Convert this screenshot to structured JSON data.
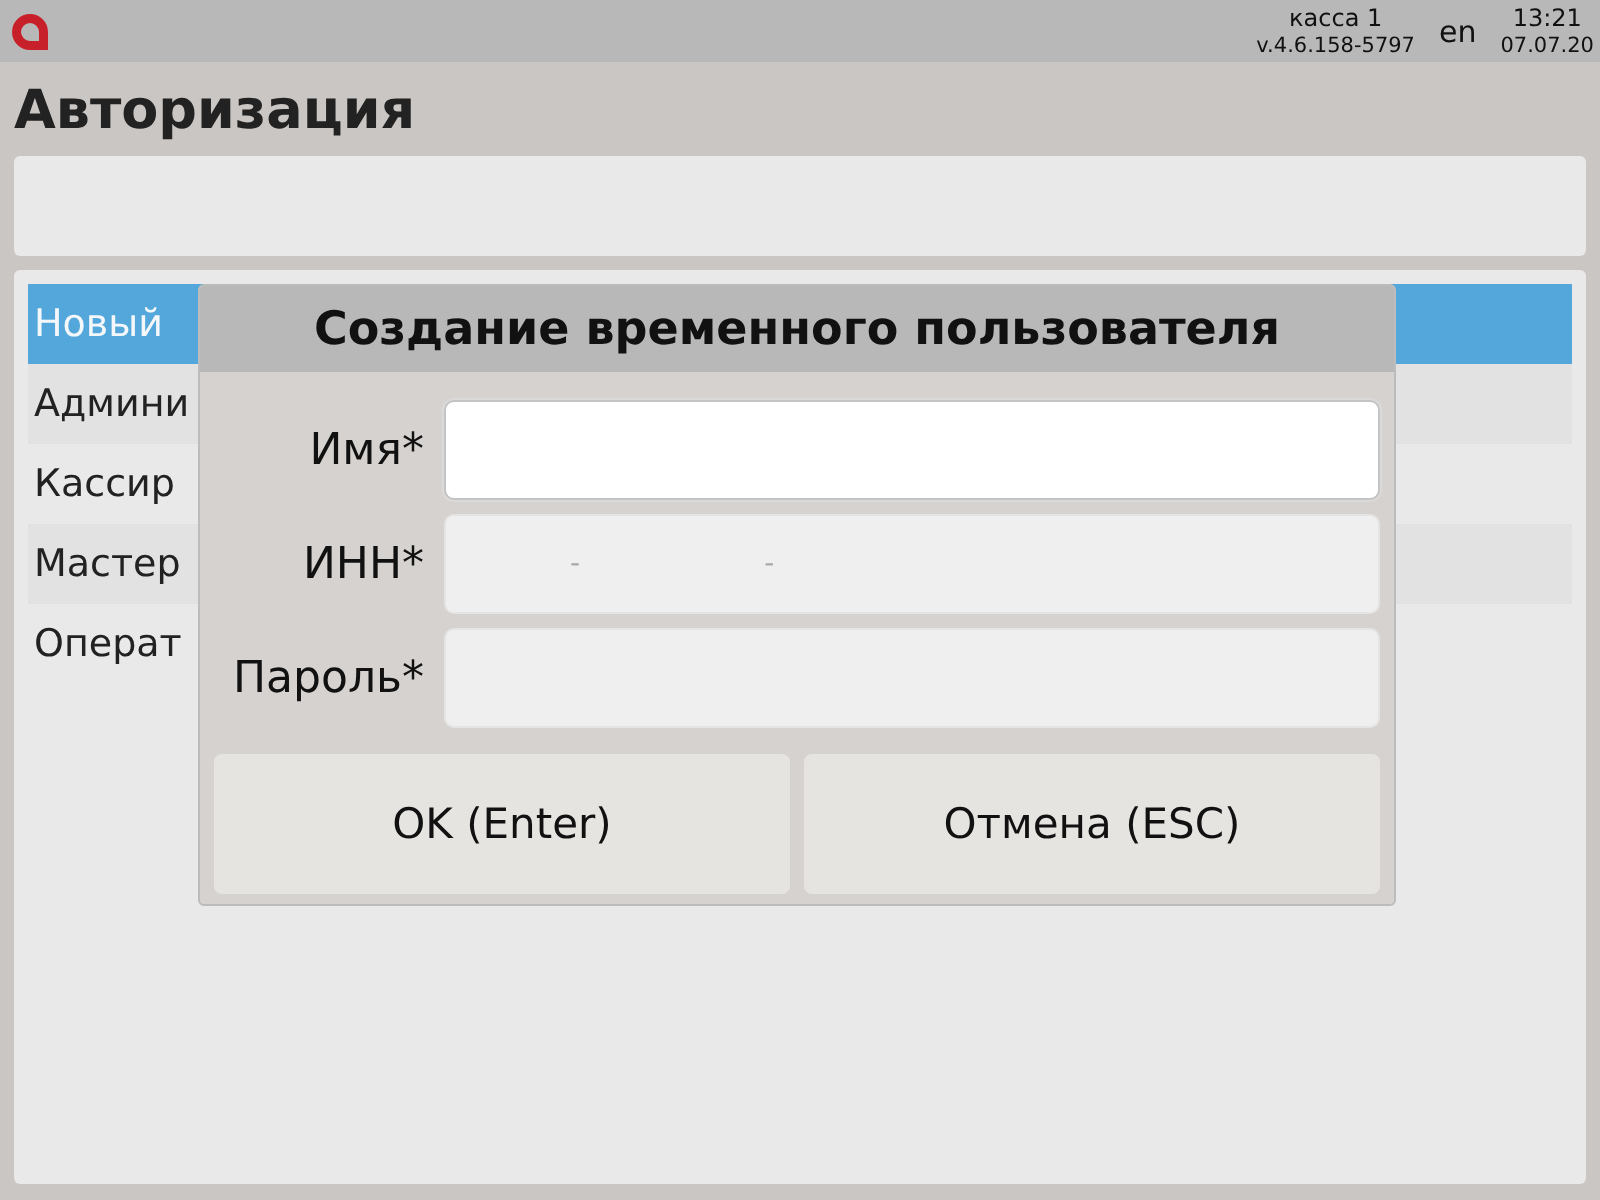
{
  "top_bar": {
    "register": "касса 1",
    "version": "v.4.6.158-5797",
    "language": "en",
    "time": "13:21",
    "date": "07.07.20"
  },
  "title": "Авторизация",
  "users": [
    {
      "label": "Новый",
      "selected": true
    },
    {
      "label": "Админи",
      "selected": false
    },
    {
      "label": "Кассир",
      "selected": false
    },
    {
      "label": "Мастер",
      "selected": false
    },
    {
      "label": "Операт",
      "selected": false
    }
  ],
  "dialog": {
    "title": "Создание временного пользователя",
    "fields": [
      {
        "label": "Имя*",
        "focused": true
      },
      {
        "label": "ИНН*",
        "focused": false,
        "mask": [
          "-",
          "-"
        ]
      },
      {
        "label": "Пароль*",
        "focused": false
      }
    ],
    "buttons": [
      "OK (Enter)",
      "Отмена (ESC)"
    ]
  }
}
